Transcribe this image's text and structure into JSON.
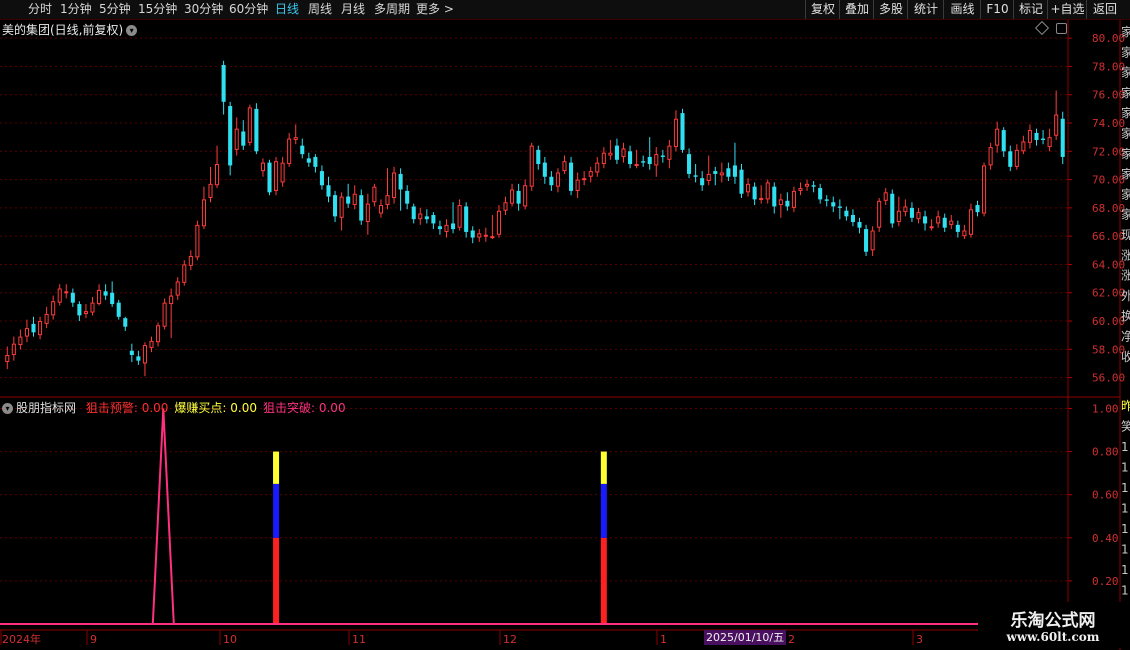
{
  "toolbar": {
    "left_items": [
      "分时",
      "1分钟",
      "5分钟",
      "15分钟",
      "30分钟",
      "60分钟",
      "日线",
      "周线",
      "月线",
      "多周期",
      "更多 >"
    ],
    "active_index": 6,
    "right_items": [
      "复权",
      "叠加",
      "多股",
      "统计",
      "画线",
      "F10",
      "标记",
      "+自选",
      "返回"
    ]
  },
  "main_chart": {
    "title": "美的集团(日线,前复权)",
    "y_ticks": [
      "80.00",
      "78.00",
      "76.00",
      "74.00",
      "72.00",
      "70.00",
      "68.00",
      "66.00",
      "64.00",
      "62.00",
      "60.00",
      "58.00",
      "56.00"
    ]
  },
  "indicator": {
    "name": "股朋指标网",
    "items": [
      {
        "label": "狙击预警: 0.00",
        "color": "#ff3030"
      },
      {
        "label": "爆赚买点: 0.00",
        "color": "#ffff40"
      },
      {
        "label": "狙击突破: 0.00",
        "color": "#ff3080"
      }
    ],
    "y_ticks": [
      "1.00",
      "0.80",
      "0.60",
      "0.40",
      "0.20"
    ]
  },
  "x_axis": {
    "labels": [
      {
        "text": "2024年",
        "x": 2
      },
      {
        "text": "9",
        "x": 90
      },
      {
        "text": "10",
        "x": 223
      },
      {
        "text": "11",
        "x": 352
      },
      {
        "text": "12",
        "x": 503
      },
      {
        "text": "1",
        "x": 660
      },
      {
        "text": "2",
        "x": 788
      },
      {
        "text": "3",
        "x": 916
      }
    ],
    "cursor_date": "2025/01/10/五"
  },
  "watermark": {
    "line1": "乐淘公式网",
    "line2": "www.60lt.com"
  },
  "right_strip": [
    "家",
    "家",
    "家",
    "家",
    "家",
    "家",
    "家",
    "家",
    "家",
    "家",
    "现",
    "涨",
    "涨",
    "外",
    "换",
    "净",
    "收"
  ],
  "right_strip_lower": [
    "昨",
    "笑",
    "1",
    "1",
    "1",
    "1",
    "1",
    "1",
    "1",
    "1"
  ],
  "colors": {
    "up": "#ff3b3b",
    "down": "#30e0f0",
    "grid": "#5a0000",
    "axis_text": "#d03030"
  },
  "chart_data": {
    "type": "candlestick",
    "series": [
      {
        "o": 57.1,
        "c": 57.6,
        "h": 58.2,
        "l": 56.6
      },
      {
        "o": 57.6,
        "c": 58.4,
        "h": 58.9,
        "l": 57.2
      },
      {
        "o": 58.3,
        "c": 58.9,
        "h": 59.4,
        "l": 58.0
      },
      {
        "o": 58.9,
        "c": 59.5,
        "h": 60.1,
        "l": 58.5
      },
      {
        "o": 59.8,
        "c": 59.2,
        "h": 60.3,
        "l": 58.9
      },
      {
        "o": 59.0,
        "c": 60.0,
        "h": 60.3,
        "l": 58.7
      },
      {
        "o": 59.8,
        "c": 60.5,
        "h": 61.0,
        "l": 59.5
      },
      {
        "o": 60.4,
        "c": 61.4,
        "h": 61.8,
        "l": 60.1
      },
      {
        "o": 61.3,
        "c": 62.3,
        "h": 62.6,
        "l": 61.1
      },
      {
        "o": 62.0,
        "c": 62.1,
        "h": 62.6,
        "l": 61.6
      },
      {
        "o": 62.0,
        "c": 61.3,
        "h": 62.3,
        "l": 61.0
      },
      {
        "o": 61.2,
        "c": 60.4,
        "h": 61.4,
        "l": 60.0
      },
      {
        "o": 60.5,
        "c": 60.7,
        "h": 61.2,
        "l": 60.2
      },
      {
        "o": 60.6,
        "c": 61.3,
        "h": 61.7,
        "l": 60.4
      },
      {
        "o": 61.2,
        "c": 62.2,
        "h": 62.6,
        "l": 61.1
      },
      {
        "o": 62.1,
        "c": 61.8,
        "h": 62.6,
        "l": 61.5
      },
      {
        "o": 62.0,
        "c": 61.2,
        "h": 62.8,
        "l": 61.0
      },
      {
        "o": 61.3,
        "c": 60.3,
        "h": 61.5,
        "l": 60.1
      },
      {
        "o": 60.2,
        "c": 59.6,
        "h": 60.3,
        "l": 59.3
      },
      {
        "o": 57.9,
        "c": 57.6,
        "h": 58.4,
        "l": 57.1
      },
      {
        "o": 57.5,
        "c": 57.2,
        "h": 57.9,
        "l": 56.9
      },
      {
        "o": 57.0,
        "c": 58.3,
        "h": 58.5,
        "l": 56.1
      },
      {
        "o": 58.1,
        "c": 58.6,
        "h": 58.9,
        "l": 57.8
      },
      {
        "o": 58.5,
        "c": 59.7,
        "h": 59.9,
        "l": 58.2
      },
      {
        "o": 59.6,
        "c": 61.3,
        "h": 61.6,
        "l": 59.4
      },
      {
        "o": 61.2,
        "c": 61.8,
        "h": 62.3,
        "l": 58.8
      },
      {
        "o": 61.8,
        "c": 62.8,
        "h": 63.1,
        "l": 61.5
      },
      {
        "o": 62.7,
        "c": 64.0,
        "h": 64.3,
        "l": 62.5
      },
      {
        "o": 63.9,
        "c": 64.6,
        "h": 65.0,
        "l": 63.6
      },
      {
        "o": 64.5,
        "c": 66.8,
        "h": 67.1,
        "l": 64.3
      },
      {
        "o": 66.7,
        "c": 68.6,
        "h": 69.5,
        "l": 66.5
      },
      {
        "o": 68.7,
        "c": 69.7,
        "h": 70.9,
        "l": 68.4
      },
      {
        "o": 69.6,
        "c": 71.1,
        "h": 72.4,
        "l": 69.4
      },
      {
        "o": 78.1,
        "c": 75.5,
        "h": 78.4,
        "l": 74.6
      },
      {
        "o": 75.2,
        "c": 71.0,
        "h": 75.5,
        "l": 70.3
      },
      {
        "o": 72.1,
        "c": 73.6,
        "h": 74.4,
        "l": 71.7
      },
      {
        "o": 73.4,
        "c": 72.4,
        "h": 74.2,
        "l": 72.1
      },
      {
        "o": 72.6,
        "c": 75.1,
        "h": 75.3,
        "l": 72.4
      },
      {
        "o": 75.0,
        "c": 72.0,
        "h": 75.4,
        "l": 71.8
      },
      {
        "o": 70.6,
        "c": 71.2,
        "h": 71.5,
        "l": 70.2
      },
      {
        "o": 71.2,
        "c": 69.1,
        "h": 71.4,
        "l": 68.9
      },
      {
        "o": 69.2,
        "c": 71.3,
        "h": 71.6,
        "l": 68.9
      },
      {
        "o": 69.8,
        "c": 71.2,
        "h": 71.6,
        "l": 69.5
      },
      {
        "o": 71.1,
        "c": 72.9,
        "h": 73.3,
        "l": 70.9
      },
      {
        "o": 72.8,
        "c": 73.0,
        "h": 73.9,
        "l": 72.5
      },
      {
        "o": 72.4,
        "c": 71.8,
        "h": 72.9,
        "l": 71.5
      },
      {
        "o": 71.5,
        "c": 71.2,
        "h": 71.9,
        "l": 70.9
      },
      {
        "o": 71.6,
        "c": 70.9,
        "h": 71.8,
        "l": 70.5
      },
      {
        "o": 70.6,
        "c": 69.6,
        "h": 71.0,
        "l": 69.3
      },
      {
        "o": 69.6,
        "c": 68.8,
        "h": 70.2,
        "l": 68.4
      },
      {
        "o": 68.9,
        "c": 67.4,
        "h": 69.2,
        "l": 67.0
      },
      {
        "o": 67.3,
        "c": 68.8,
        "h": 69.1,
        "l": 66.4
      },
      {
        "o": 68.8,
        "c": 68.3,
        "h": 69.7,
        "l": 68.0
      },
      {
        "o": 68.2,
        "c": 69.0,
        "h": 69.6,
        "l": 67.9
      },
      {
        "o": 68.9,
        "c": 67.1,
        "h": 69.3,
        "l": 66.8
      },
      {
        "o": 67.0,
        "c": 68.3,
        "h": 69.0,
        "l": 66.1
      },
      {
        "o": 68.4,
        "c": 69.5,
        "h": 69.7,
        "l": 68.1
      },
      {
        "o": 67.6,
        "c": 68.2,
        "h": 68.6,
        "l": 67.3
      },
      {
        "o": 68.2,
        "c": 68.9,
        "h": 70.8,
        "l": 67.9
      },
      {
        "o": 68.7,
        "c": 70.5,
        "h": 70.9,
        "l": 68.3
      },
      {
        "o": 70.4,
        "c": 69.3,
        "h": 70.8,
        "l": 67.8
      },
      {
        "o": 69.2,
        "c": 68.3,
        "h": 69.6,
        "l": 67.9
      },
      {
        "o": 68.1,
        "c": 67.2,
        "h": 68.3,
        "l": 66.9
      },
      {
        "o": 67.2,
        "c": 67.6,
        "h": 68.0,
        "l": 66.8
      },
      {
        "o": 67.4,
        "c": 67.2,
        "h": 67.9,
        "l": 66.9
      },
      {
        "o": 67.5,
        "c": 66.9,
        "h": 67.7,
        "l": 66.5
      },
      {
        "o": 66.7,
        "c": 66.5,
        "h": 67.1,
        "l": 66.1
      },
      {
        "o": 66.3,
        "c": 66.8,
        "h": 67.2,
        "l": 65.9
      },
      {
        "o": 66.9,
        "c": 66.5,
        "h": 68.4,
        "l": 66.2
      },
      {
        "o": 66.6,
        "c": 68.2,
        "h": 68.6,
        "l": 66.4
      },
      {
        "o": 68.1,
        "c": 66.3,
        "h": 68.4,
        "l": 65.9
      },
      {
        "o": 66.4,
        "c": 65.9,
        "h": 66.7,
        "l": 65.5
      },
      {
        "o": 65.9,
        "c": 66.2,
        "h": 66.5,
        "l": 65.6
      },
      {
        "o": 66.1,
        "c": 66.1,
        "h": 66.6,
        "l": 65.6
      },
      {
        "o": 66.0,
        "c": 66.0,
        "h": 67.5,
        "l": 65.8
      },
      {
        "o": 66.1,
        "c": 67.8,
        "h": 68.2,
        "l": 65.9
      },
      {
        "o": 67.8,
        "c": 68.4,
        "h": 68.8,
        "l": 67.5
      },
      {
        "o": 68.3,
        "c": 69.3,
        "h": 69.7,
        "l": 68.1
      },
      {
        "o": 69.2,
        "c": 68.3,
        "h": 69.7,
        "l": 67.8
      },
      {
        "o": 68.1,
        "c": 69.6,
        "h": 70.0,
        "l": 67.9
      },
      {
        "o": 69.5,
        "c": 72.4,
        "h": 72.6,
        "l": 69.2
      },
      {
        "o": 72.1,
        "c": 71.1,
        "h": 72.4,
        "l": 70.7
      },
      {
        "o": 71.2,
        "c": 70.2,
        "h": 71.6,
        "l": 69.7
      },
      {
        "o": 70.2,
        "c": 69.6,
        "h": 70.6,
        "l": 69.2
      },
      {
        "o": 69.5,
        "c": 70.5,
        "h": 70.8,
        "l": 69.1
      },
      {
        "o": 70.6,
        "c": 71.3,
        "h": 71.7,
        "l": 70.4
      },
      {
        "o": 71.2,
        "c": 69.2,
        "h": 71.6,
        "l": 68.9
      },
      {
        "o": 69.2,
        "c": 70.0,
        "h": 70.5,
        "l": 68.7
      },
      {
        "o": 70.0,
        "c": 70.1,
        "h": 70.6,
        "l": 69.6
      },
      {
        "o": 70.2,
        "c": 70.6,
        "h": 70.9,
        "l": 69.8
      },
      {
        "o": 70.5,
        "c": 71.2,
        "h": 71.6,
        "l": 70.2
      },
      {
        "o": 71.1,
        "c": 71.9,
        "h": 72.3,
        "l": 70.8
      },
      {
        "o": 71.7,
        "c": 71.9,
        "h": 72.8,
        "l": 71.4
      },
      {
        "o": 72.4,
        "c": 71.4,
        "h": 72.9,
        "l": 71.1
      },
      {
        "o": 71.6,
        "c": 72.2,
        "h": 72.6,
        "l": 71.2
      },
      {
        "o": 72.0,
        "c": 71.1,
        "h": 72.4,
        "l": 70.8
      },
      {
        "o": 71.1,
        "c": 71.1,
        "h": 72.1,
        "l": 70.8
      },
      {
        "o": 71.3,
        "c": 71.2,
        "h": 71.7,
        "l": 70.9
      },
      {
        "o": 71.6,
        "c": 71.1,
        "h": 73.0,
        "l": 70.7
      },
      {
        "o": 71.0,
        "c": 71.8,
        "h": 72.3,
        "l": 70.2
      },
      {
        "o": 71.7,
        "c": 71.6,
        "h": 72.1,
        "l": 71.2
      },
      {
        "o": 71.4,
        "c": 72.4,
        "h": 72.8,
        "l": 70.8
      },
      {
        "o": 72.3,
        "c": 74.3,
        "h": 74.9,
        "l": 72.0
      },
      {
        "o": 74.7,
        "c": 72.1,
        "h": 75.0,
        "l": 71.9
      },
      {
        "o": 71.8,
        "c": 70.4,
        "h": 72.2,
        "l": 70.1
      },
      {
        "o": 70.3,
        "c": 70.2,
        "h": 71.1,
        "l": 69.8
      },
      {
        "o": 70.1,
        "c": 69.6,
        "h": 70.6,
        "l": 69.2
      },
      {
        "o": 69.9,
        "c": 70.4,
        "h": 71.7,
        "l": 69.6
      },
      {
        "o": 70.6,
        "c": 70.4,
        "h": 70.9,
        "l": 69.6
      },
      {
        "o": 70.3,
        "c": 70.5,
        "h": 71.2,
        "l": 69.8
      },
      {
        "o": 70.8,
        "c": 70.2,
        "h": 71.2,
        "l": 69.9
      },
      {
        "o": 71.0,
        "c": 70.2,
        "h": 72.6,
        "l": 69.7
      },
      {
        "o": 70.7,
        "c": 69.0,
        "h": 71.1,
        "l": 68.7
      },
      {
        "o": 69.1,
        "c": 69.7,
        "h": 70.1,
        "l": 68.8
      },
      {
        "o": 69.5,
        "c": 68.6,
        "h": 69.8,
        "l": 68.2
      },
      {
        "o": 68.6,
        "c": 68.7,
        "h": 69.6,
        "l": 68.3
      },
      {
        "o": 68.6,
        "c": 69.8,
        "h": 70.0,
        "l": 68.3
      },
      {
        "o": 69.5,
        "c": 68.1,
        "h": 69.8,
        "l": 67.6
      },
      {
        "o": 68.2,
        "c": 68.6,
        "h": 69.0,
        "l": 67.3
      },
      {
        "o": 68.5,
        "c": 68.1,
        "h": 69.1,
        "l": 67.8
      },
      {
        "o": 68.0,
        "c": 69.2,
        "h": 69.5,
        "l": 67.7
      },
      {
        "o": 69.2,
        "c": 69.4,
        "h": 69.8,
        "l": 68.9
      },
      {
        "o": 69.5,
        "c": 69.7,
        "h": 70.0,
        "l": 69.2
      },
      {
        "o": 69.6,
        "c": 69.5,
        "h": 69.9,
        "l": 69.1
      },
      {
        "o": 69.4,
        "c": 68.6,
        "h": 69.7,
        "l": 68.3
      },
      {
        "o": 68.6,
        "c": 68.5,
        "h": 68.9,
        "l": 68.1
      },
      {
        "o": 68.4,
        "c": 68.1,
        "h": 68.8,
        "l": 67.7
      },
      {
        "o": 68.1,
        "c": 68.0,
        "h": 68.6,
        "l": 67.2
      },
      {
        "o": 67.8,
        "c": 67.4,
        "h": 68.1,
        "l": 67.1
      },
      {
        "o": 67.5,
        "c": 67.0,
        "h": 67.9,
        "l": 66.7
      },
      {
        "o": 67.0,
        "c": 66.6,
        "h": 67.3,
        "l": 66.2
      },
      {
        "o": 66.5,
        "c": 64.9,
        "h": 66.8,
        "l": 64.6
      },
      {
        "o": 65.0,
        "c": 66.4,
        "h": 66.7,
        "l": 64.6
      },
      {
        "o": 66.6,
        "c": 68.5,
        "h": 68.7,
        "l": 66.3
      },
      {
        "o": 68.5,
        "c": 69.1,
        "h": 69.4,
        "l": 68.2
      },
      {
        "o": 69.0,
        "c": 66.9,
        "h": 69.3,
        "l": 66.6
      },
      {
        "o": 67.0,
        "c": 67.8,
        "h": 68.8,
        "l": 66.7
      },
      {
        "o": 67.7,
        "c": 68.1,
        "h": 68.6,
        "l": 67.4
      },
      {
        "o": 68.0,
        "c": 67.3,
        "h": 68.4,
        "l": 67.0
      },
      {
        "o": 67.2,
        "c": 67.7,
        "h": 68.0,
        "l": 66.9
      },
      {
        "o": 67.4,
        "c": 66.9,
        "h": 67.8,
        "l": 66.4
      },
      {
        "o": 66.7,
        "c": 66.7,
        "h": 67.2,
        "l": 66.4
      },
      {
        "o": 66.9,
        "c": 67.4,
        "h": 67.8,
        "l": 66.6
      },
      {
        "o": 67.3,
        "c": 66.6,
        "h": 67.6,
        "l": 66.3
      },
      {
        "o": 66.8,
        "c": 67.1,
        "h": 67.5,
        "l": 66.5
      },
      {
        "o": 66.8,
        "c": 66.3,
        "h": 67.1,
        "l": 65.9
      },
      {
        "o": 66.0,
        "c": 66.4,
        "h": 66.8,
        "l": 65.8
      },
      {
        "o": 66.1,
        "c": 67.9,
        "h": 68.3,
        "l": 65.9
      },
      {
        "o": 68.2,
        "c": 67.7,
        "h": 68.5,
        "l": 67.4
      },
      {
        "o": 67.6,
        "c": 71.0,
        "h": 71.2,
        "l": 67.4
      },
      {
        "o": 71.0,
        "c": 72.3,
        "h": 72.6,
        "l": 70.7
      },
      {
        "o": 72.4,
        "c": 73.6,
        "h": 74.1,
        "l": 71.9
      },
      {
        "o": 73.5,
        "c": 72.0,
        "h": 73.7,
        "l": 71.6
      },
      {
        "o": 72.0,
        "c": 70.9,
        "h": 72.4,
        "l": 70.6
      },
      {
        "o": 70.9,
        "c": 72.1,
        "h": 72.5,
        "l": 70.7
      },
      {
        "o": 72.0,
        "c": 72.7,
        "h": 73.1,
        "l": 71.8
      },
      {
        "o": 72.6,
        "c": 73.5,
        "h": 73.9,
        "l": 72.2
      },
      {
        "o": 73.3,
        "c": 72.8,
        "h": 73.6,
        "l": 72.4
      },
      {
        "o": 72.9,
        "c": 72.8,
        "h": 73.5,
        "l": 72.5
      },
      {
        "o": 72.3,
        "c": 73.0,
        "h": 73.6,
        "l": 72.0
      },
      {
        "o": 73.1,
        "c": 74.6,
        "h": 76.3,
        "l": 72.8
      },
      {
        "o": 74.3,
        "c": 71.6,
        "h": 74.8,
        "l": 71.1
      }
    ],
    "indicator": {
      "type": "bar",
      "spike_1": {
        "center_index": 25,
        "value": 1.0,
        "color": "#ff3080"
      },
      "bars": [
        {
          "index": 41,
          "red": 0.4,
          "blue": 0.65,
          "yellow": 0.8
        },
        {
          "index": 91,
          "red": 0.4,
          "blue": 0.65,
          "yellow": 0.8
        }
      ]
    }
  }
}
